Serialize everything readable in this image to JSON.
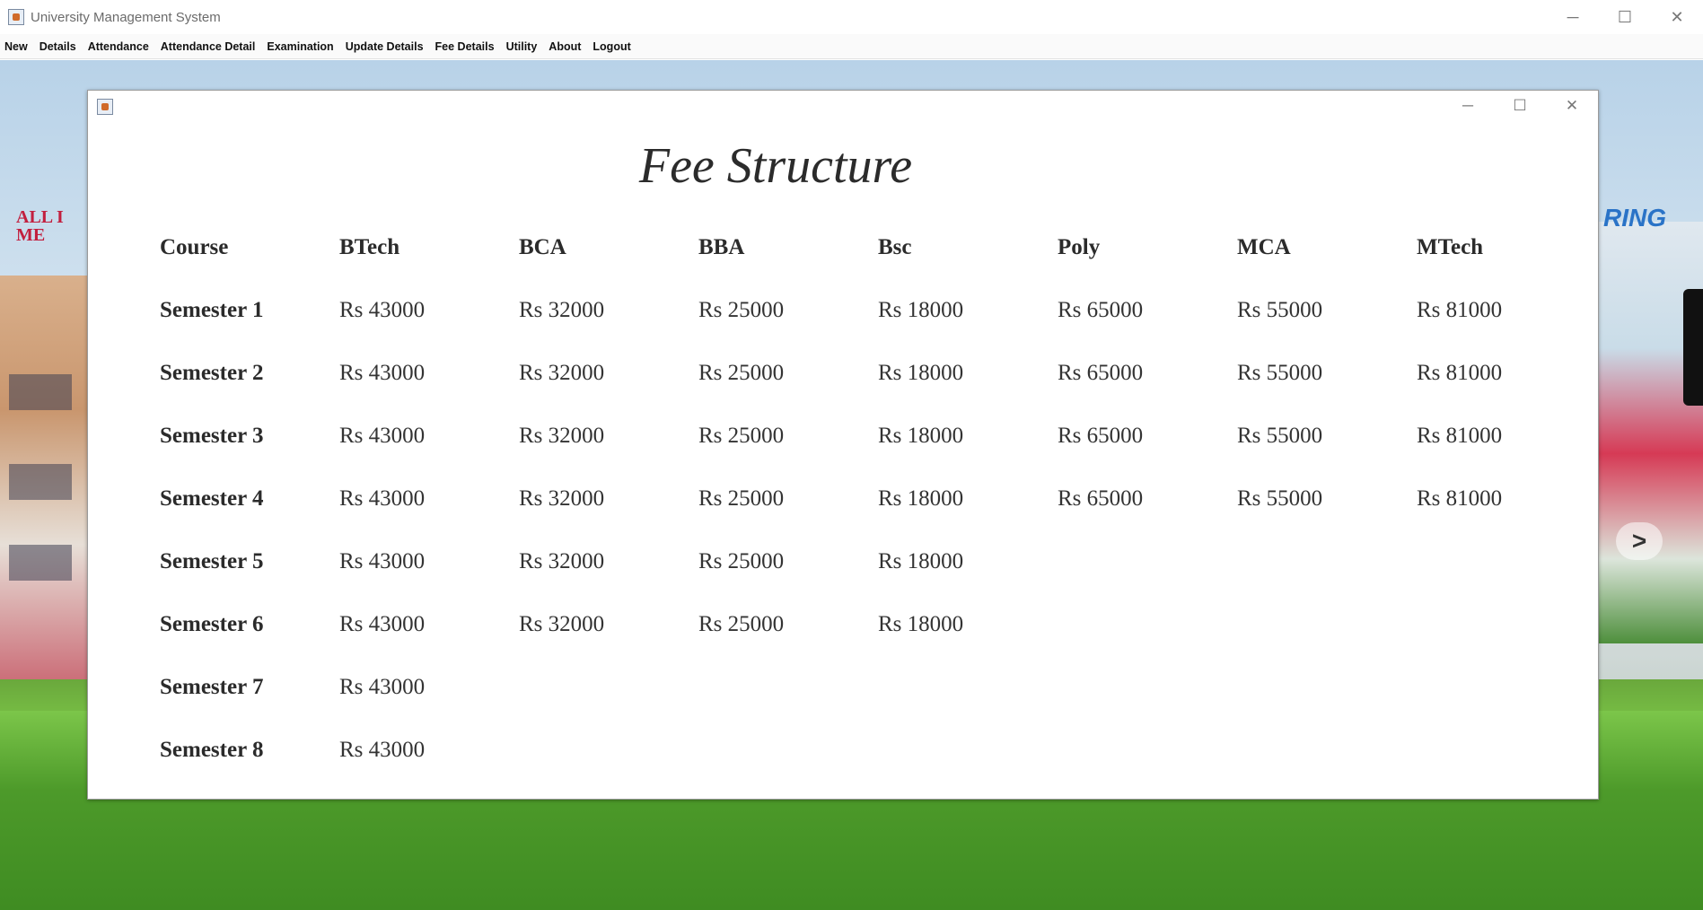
{
  "window": {
    "title": "University Management System",
    "controls": {
      "minimize": "─",
      "maximize": "☐",
      "close": "✕"
    }
  },
  "menu": [
    "New",
    "Details",
    "Attendance",
    "Attendance Detail",
    "Examination",
    "Update Details",
    "Fee Details",
    "Utility",
    "About",
    "Logout"
  ],
  "background": {
    "sign_left": "ALL I\nME",
    "sign_right": "RING",
    "nav_arrow": ">"
  },
  "frame": {
    "controls": {
      "minimize": "─",
      "maximize": "☐",
      "close": "✕"
    },
    "heading": "Fee Structure",
    "columns": [
      "Course",
      "BTech",
      "BCA",
      "BBA",
      "Bsc",
      "Poly",
      "MCA",
      "MTech"
    ],
    "rows": [
      {
        "label": "Semester 1",
        "values": [
          "Rs 43000",
          "Rs 32000",
          "Rs 25000",
          "Rs 18000",
          "Rs 65000",
          "Rs 55000",
          "Rs 81000"
        ]
      },
      {
        "label": "Semester 2",
        "values": [
          "Rs 43000",
          "Rs 32000",
          "Rs 25000",
          "Rs 18000",
          "Rs 65000",
          "Rs 55000",
          "Rs 81000"
        ]
      },
      {
        "label": "Semester 3",
        "values": [
          "Rs 43000",
          "Rs 32000",
          "Rs 25000",
          "Rs 18000",
          "Rs 65000",
          "Rs 55000",
          "Rs 81000"
        ]
      },
      {
        "label": "Semester 4",
        "values": [
          "Rs 43000",
          "Rs 32000",
          "Rs 25000",
          "Rs 18000",
          "Rs 65000",
          "Rs 55000",
          "Rs 81000"
        ]
      },
      {
        "label": "Semester 5",
        "values": [
          "Rs 43000",
          "Rs 32000",
          "Rs 25000",
          "Rs 18000",
          "",
          "",
          ""
        ]
      },
      {
        "label": "Semester 6",
        "values": [
          "Rs 43000",
          "Rs 32000",
          "Rs 25000",
          "Rs 18000",
          "",
          "",
          ""
        ]
      },
      {
        "label": "Semester 7",
        "values": [
          "Rs 43000",
          "",
          "",
          "",
          "",
          "",
          ""
        ]
      },
      {
        "label": "Semester 8",
        "values": [
          "Rs 43000",
          "",
          "",
          "",
          "",
          "",
          ""
        ]
      }
    ]
  }
}
